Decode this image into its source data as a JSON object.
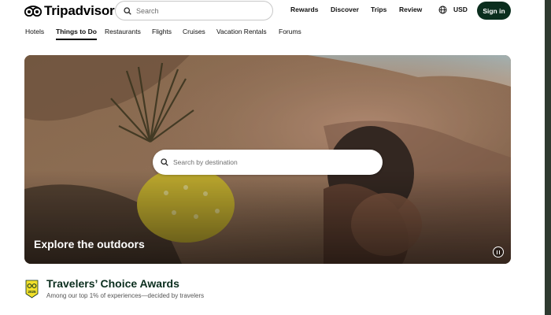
{
  "header": {
    "logo_text": "Tripadvisor",
    "search_placeholder": "Search",
    "nav": [
      {
        "label": "Rewards"
      },
      {
        "label": "Discover"
      },
      {
        "label": "Trips"
      },
      {
        "label": "Review"
      }
    ],
    "currency": "USD",
    "signin_label": "Sign in"
  },
  "tabs": [
    {
      "label": "Hotels"
    },
    {
      "label": "Things to Do",
      "active": true
    },
    {
      "label": "Restaurants"
    },
    {
      "label": "Flights"
    },
    {
      "label": "Cruises"
    },
    {
      "label": "Vacation Rentals"
    },
    {
      "label": "Forums"
    }
  ],
  "hero": {
    "search_placeholder": "Search by destination",
    "title": "Explore the outdoors",
    "pause_icon": "pause-icon"
  },
  "awards": {
    "title": "Travelers’ Choice Awards",
    "subtitle": "Among our top 1% of experiences—decided by travelers",
    "badge_year": "2025"
  },
  "colors": {
    "brand_dark": "#0b2e1e",
    "badge_yellow": "#f2e02b"
  }
}
